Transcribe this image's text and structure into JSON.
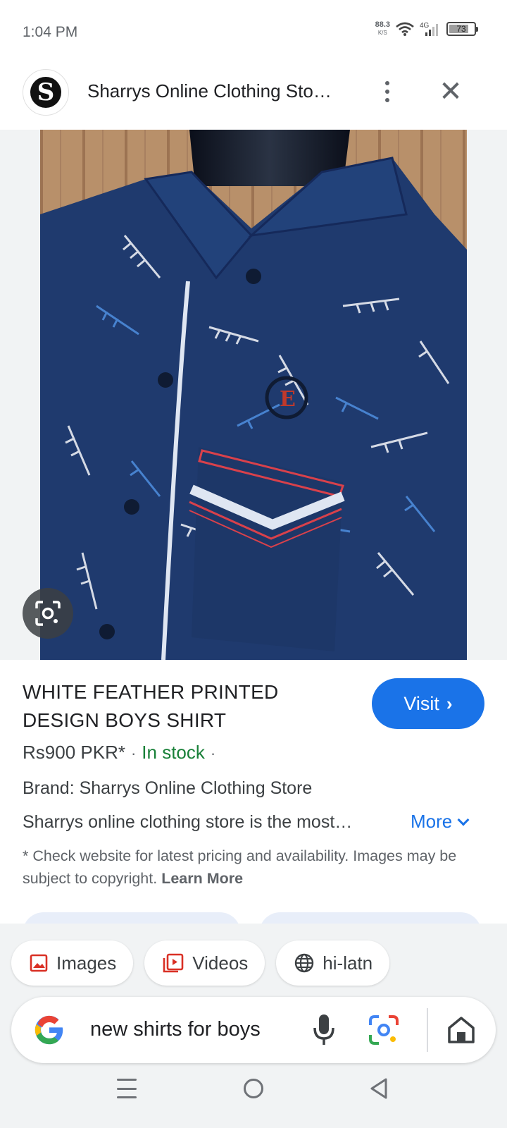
{
  "status_bar": {
    "time": "1:04 PM",
    "net_speed": "88.3",
    "net_speed_unit": "K/S",
    "network": "4G",
    "battery": "73"
  },
  "header": {
    "site_logo_letter": "S",
    "title": "Sharrys Online Clothing Sto…"
  },
  "product": {
    "title": "WHITE FEATHER PRINTED DESIGN BOYS SHIRT",
    "visit_label": "Visit",
    "price": "Rs900 PKR*",
    "separator": "·",
    "stock": "In stock",
    "brand": "Brand: Sharrys Online Clothing Store",
    "description": "Sharrys online clothing store is the most…",
    "more_label": "More",
    "disclaimer": "* Check website for latest pricing and availability. Images may be subject to copyright.",
    "learn_more": "Learn More"
  },
  "chips": [
    {
      "label": "Images",
      "icon": "image-icon"
    },
    {
      "label": "Videos",
      "icon": "video-icon"
    },
    {
      "label": "hi-latn",
      "icon": "globe-icon"
    }
  ],
  "search": {
    "query": "new shirts for boys"
  },
  "colors": {
    "accent": "#1a73e8",
    "in_stock": "#188038",
    "shirt": "#1f3a6e"
  }
}
